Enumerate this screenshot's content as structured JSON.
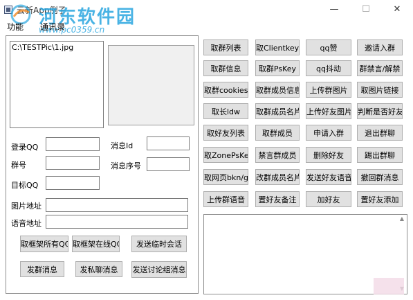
{
  "window": {
    "title": "云新App例子",
    "minimize": "—",
    "maximize": "☐",
    "close": "✕"
  },
  "watermark": {
    "main": "河东软件园",
    "url": "www.pc0359.cn"
  },
  "tabs": [
    {
      "label": "功能"
    },
    {
      "label": "通讯录"
    }
  ],
  "file_list": {
    "items": [
      "C:\\TESTPic\\1.jpg"
    ]
  },
  "form": {
    "login_qq": {
      "label": "登录QQ",
      "value": ""
    },
    "msg_id": {
      "label": "消息Id",
      "value": ""
    },
    "group": {
      "label": "群号",
      "value": ""
    },
    "msg_seq": {
      "label": "消息序号",
      "value": ""
    },
    "target_qq": {
      "label": "目标QQ",
      "value": ""
    },
    "image_url": {
      "label": "图片地址",
      "value": ""
    },
    "voice_url": {
      "label": "语音地址",
      "value": ""
    }
  },
  "left_buttons": {
    "get_all_qq": "取框架所有QQ",
    "get_online_qq": "取框架在线QQ",
    "send_temp_session": "发送临时会话",
    "send_group_msg": "发群消息",
    "send_private_msg": "发私聊消息",
    "send_discussion_msg": "发送讨论组消息"
  },
  "grid_buttons": [
    [
      "取群列表",
      "取Clientkey",
      "qq赞",
      "邀请入群"
    ],
    [
      "取群信息",
      "取群PsKey",
      "qq抖动",
      "群禁言/解禁"
    ],
    [
      "取群cookies",
      "取群成员信息",
      "上传群图片",
      "取图片链接"
    ],
    [
      "取长ldw",
      "取群成员名片",
      "上传好友图片",
      "判断是否好友"
    ],
    [
      "取好友列表",
      "取群成员",
      "申请入群",
      "退出群聊"
    ],
    [
      "取ZonePsKey",
      "禁言群成员",
      "删除好友",
      "踢出群聊"
    ],
    [
      "取网页bkn/gtk",
      "改群成员名片",
      "发送好友语音",
      "撤回群消息"
    ],
    [
      "上传群语音",
      "置好友备注",
      "加好友",
      "置好友添加"
    ]
  ],
  "output": {
    "value": ""
  },
  "icons": {
    "scroll_up": "scroll-up-icon",
    "scroll_down": "scroll-down-icon"
  }
}
